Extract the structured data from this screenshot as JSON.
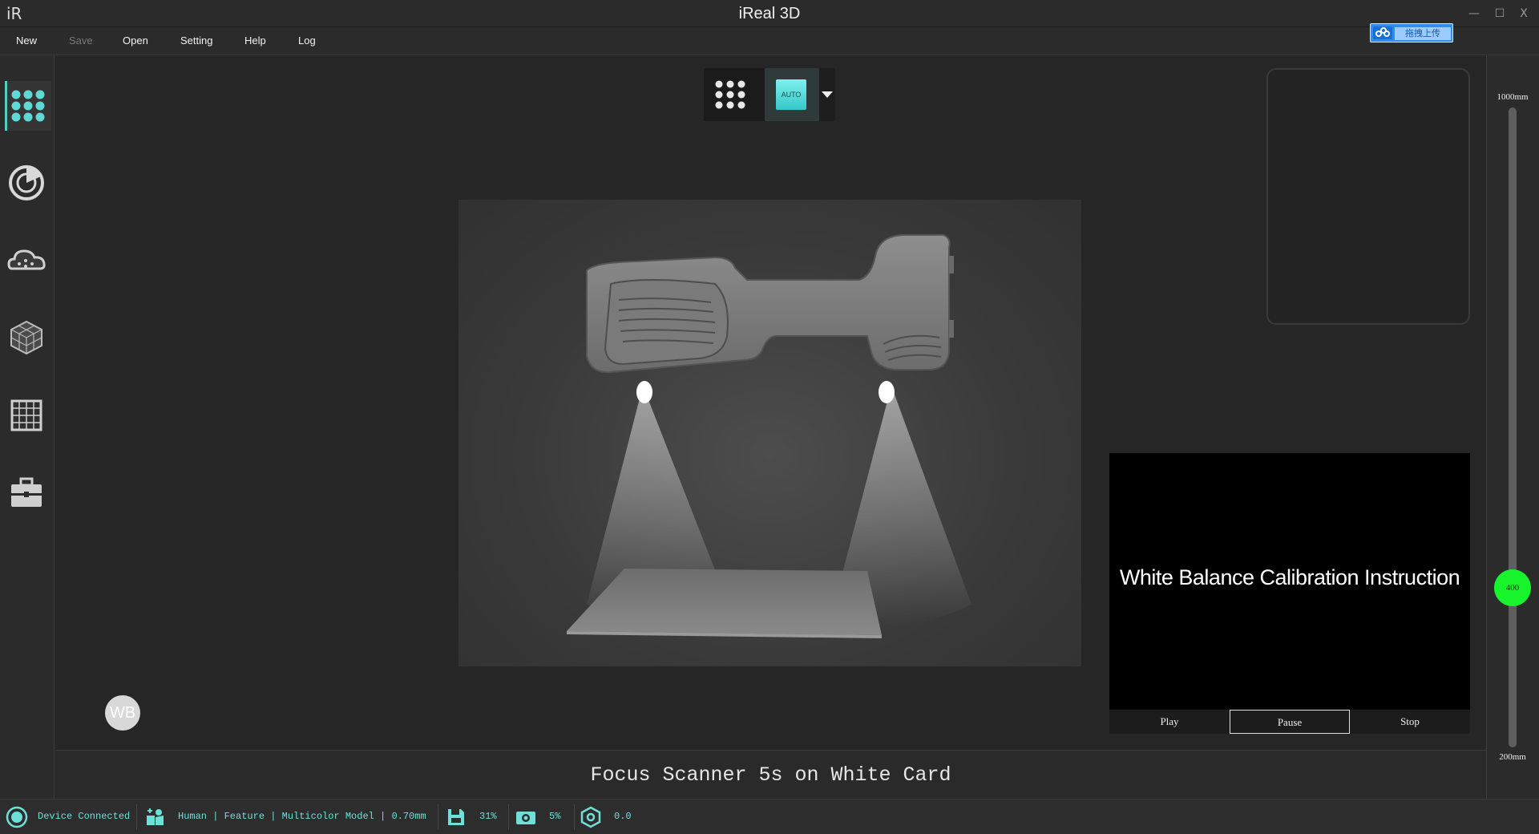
{
  "window": {
    "title": "iReal 3D",
    "logo_text": "iR",
    "minimize_glyph": "—",
    "maximize_glyph": "☐",
    "close_glyph": "X"
  },
  "upload_badge": {
    "icon": "cloud-upload-icon",
    "label": "拖拽上传",
    "color": "#2f8df0"
  },
  "menu": {
    "new": "New",
    "save": "Save",
    "open": "Open",
    "setting": "Setting",
    "help": "Help",
    "log": "Log"
  },
  "sidebar": {
    "items": [
      {
        "name": "scan-mode",
        "icon": "dot-grid-icon",
        "active": true
      },
      {
        "name": "calibration",
        "icon": "dial-icon",
        "active": false
      },
      {
        "name": "cloud",
        "icon": "cloud-icon",
        "active": false
      },
      {
        "name": "mesh",
        "icon": "mesh-cube-icon",
        "active": false
      },
      {
        "name": "grid",
        "icon": "grid-icon",
        "active": false
      },
      {
        "name": "toolbox",
        "icon": "toolbox-icon",
        "active": false
      }
    ]
  },
  "mode_selector": {
    "auto_label": "AUTO",
    "accent": "#4ecfc9"
  },
  "video": {
    "title": "White Balance Calibration Instruction",
    "play": "Play",
    "pause": "Pause",
    "stop": "Stop"
  },
  "wb_button": "WB",
  "instruction": "Focus Scanner 5s on White Card",
  "distance": {
    "max_label": "1000mm",
    "min_label": "200mm",
    "value": 400,
    "min": 200,
    "max": 1000,
    "handle_color": "#17f42b"
  },
  "status": {
    "device": "Device Connected",
    "profile": "Human | Feature | Multicolor Model | 0.70mm",
    "storage": "31%",
    "camera": "5%",
    "hex_value": "0.0",
    "text_color": "#6fe0d8"
  }
}
